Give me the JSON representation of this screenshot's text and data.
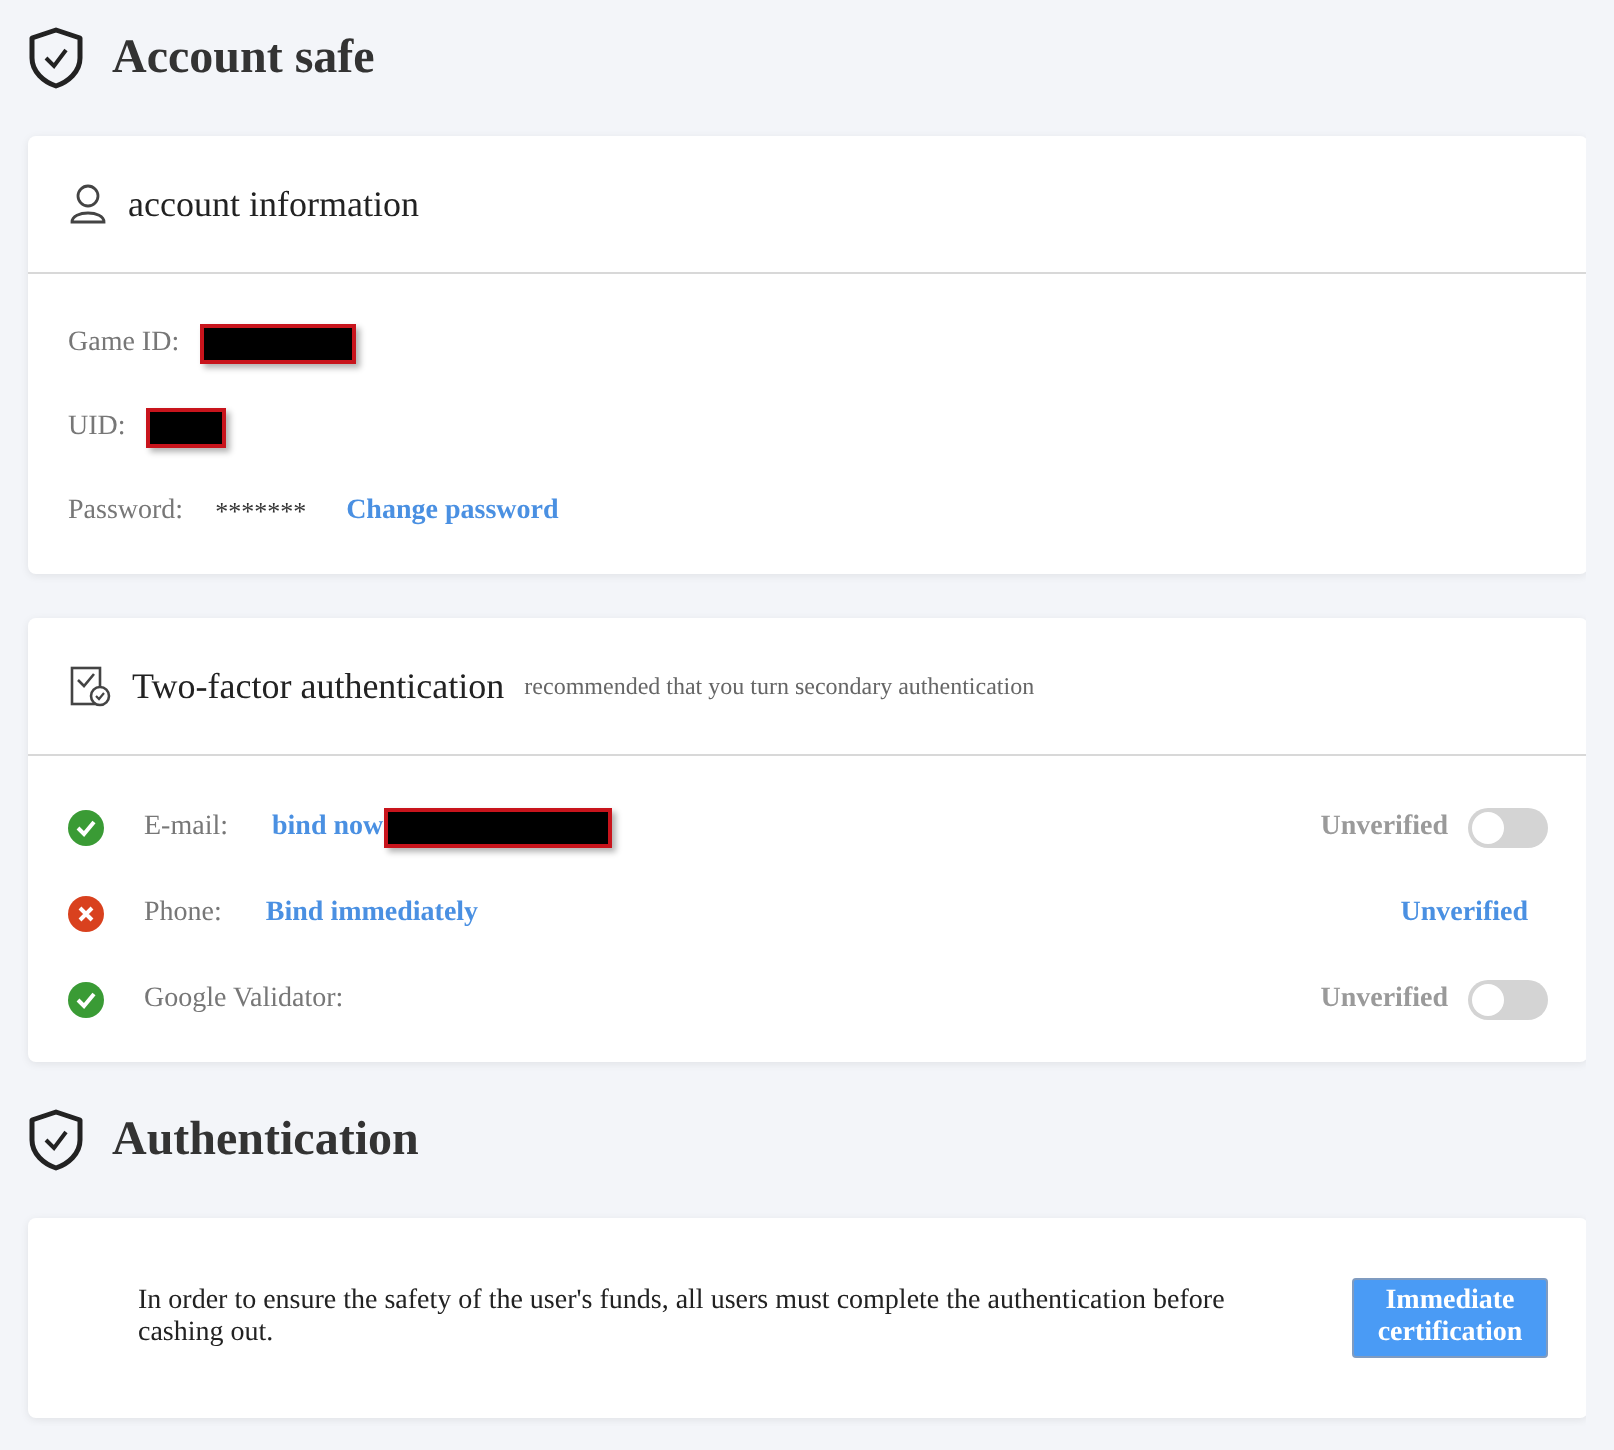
{
  "account_section": {
    "title": "Account safe"
  },
  "account_card": {
    "title": "account information",
    "fields": [
      {
        "label": "Game ID:",
        "redacted": true,
        "kind": "redacted"
      },
      {
        "label": "UID:",
        "redacted": true,
        "kind": "redacted"
      },
      {
        "label": "Password:",
        "kind": "password",
        "value": "*******",
        "link": "Change password"
      }
    ]
  },
  "twofa_card": {
    "title": "Two-factor authentication",
    "note": "recommended that you turn secondary authentication",
    "rows": [
      {
        "label": "E-mail:",
        "ok": true,
        "link": "bind now",
        "redacted": true,
        "status": "Unverified",
        "kind": "toggle",
        "on": false
      },
      {
        "label": "Phone:",
        "ok": false,
        "link": "Bind immediately",
        "status": "Unverified",
        "kind": "link"
      },
      {
        "label": "Google Validator:",
        "ok": true,
        "status": "Unverified",
        "kind": "toggle",
        "on": false
      }
    ]
  },
  "auth_section": {
    "title": "Authentication"
  },
  "auth_card": {
    "text": "In order to ensure the safety of the user's funds, all users must complete the authentication before cashing out.",
    "button": "Immediate certification"
  }
}
